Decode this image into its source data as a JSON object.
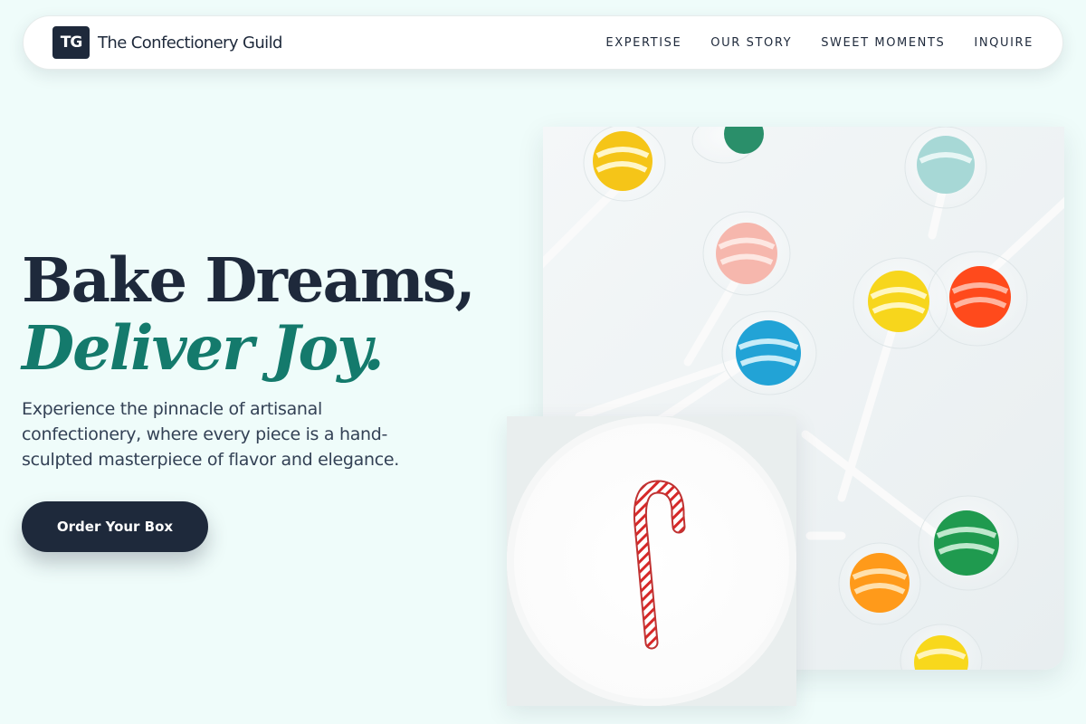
{
  "nav": {
    "logo_mark": "TG",
    "brand": "The Confectionery Guild",
    "links": [
      "EXPERTISE",
      "OUR STORY",
      "SWEET MOMENTS",
      "INQUIRE"
    ]
  },
  "hero": {
    "title_line1": "Bake Dreams,",
    "title_line2": "Deliver Joy.",
    "description": "Experience the pinnacle of artisanal confectionery, where every piece is a hand-sculpted masterpiece of flavor and elegance.",
    "cta_label": "Order Your Box"
  },
  "colors": {
    "background": "#effcfa",
    "primary": "#1e293b",
    "accent": "#147a6c"
  },
  "images": {
    "main_photo": "lollipops-photo",
    "plate_photo": "candy-cane-plate"
  }
}
